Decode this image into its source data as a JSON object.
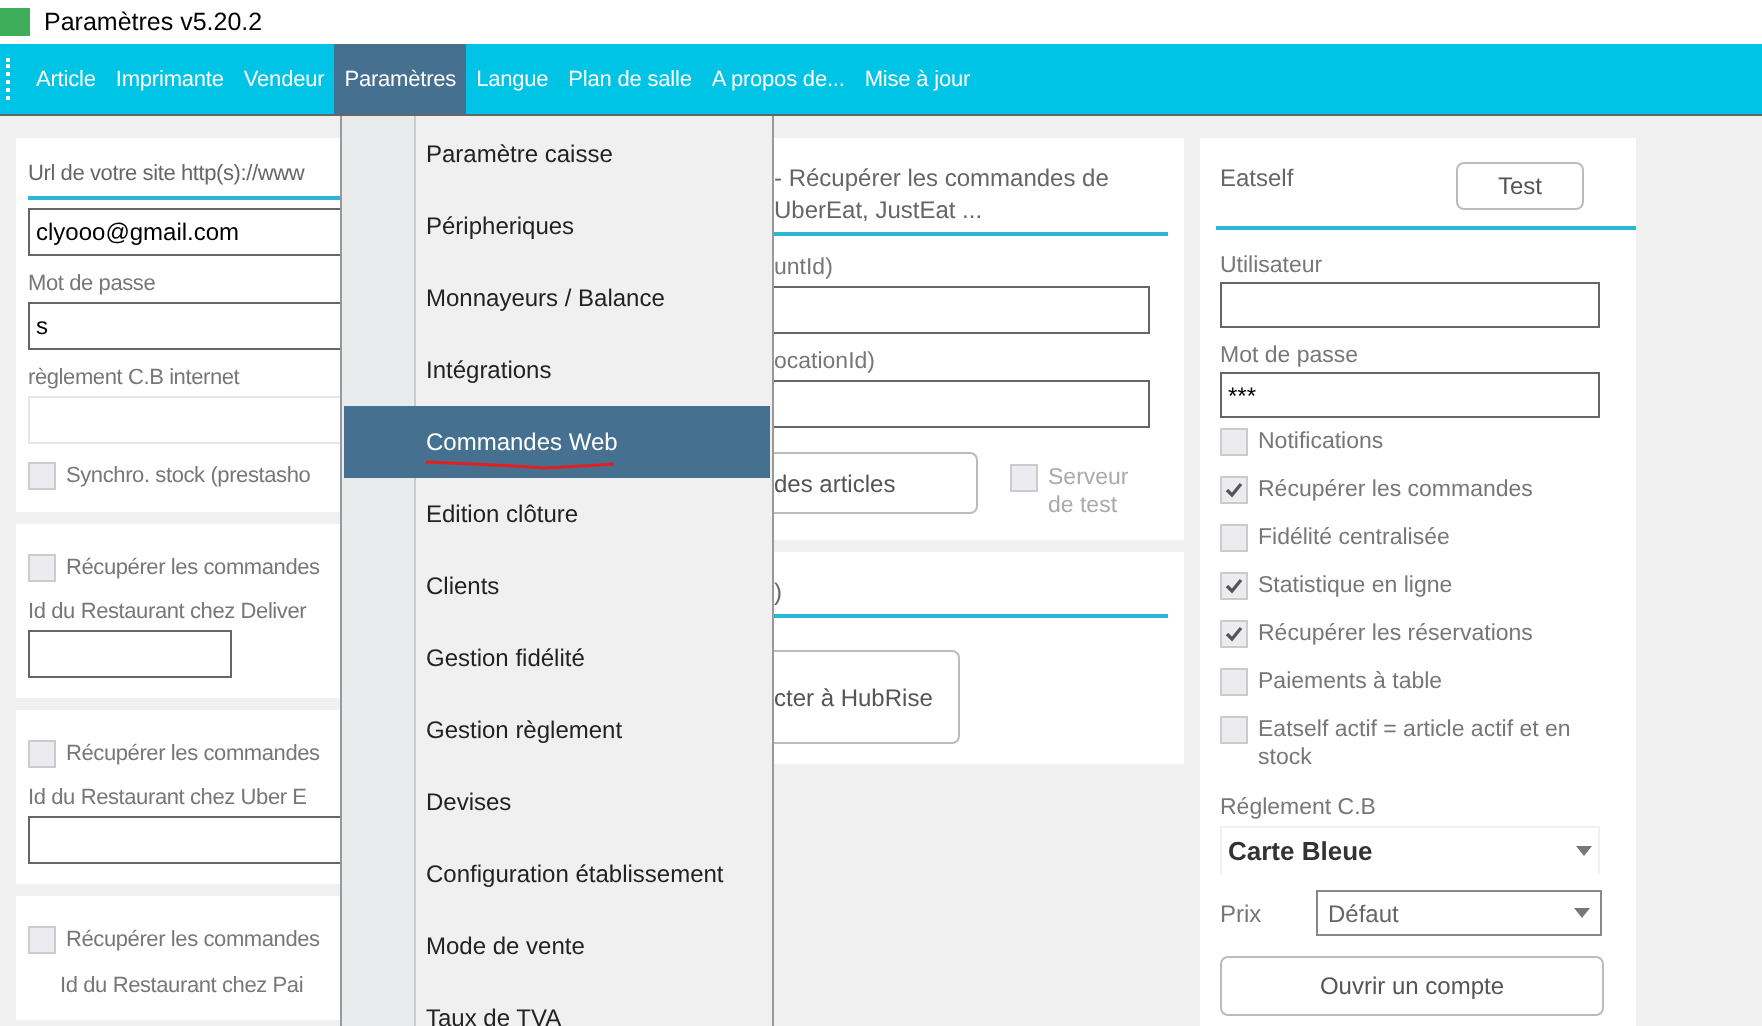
{
  "window": {
    "title": "Paramètres v5.20.2"
  },
  "menu_bar": [
    {
      "label": "Article",
      "selected": false
    },
    {
      "label": "Imprimante",
      "selected": false
    },
    {
      "label": "Vendeur",
      "selected": false
    },
    {
      "label": "Paramètres",
      "selected": true
    },
    {
      "label": "Langue",
      "selected": false
    },
    {
      "label": "Plan de salle",
      "selected": false
    },
    {
      "label": "A propos de...",
      "selected": false
    },
    {
      "label": "Mise à jour",
      "selected": false
    }
  ],
  "left_panels": [
    {
      "title": "Url de votre site http(s)://www",
      "rows": [
        {
          "kind": "input",
          "value": "clyooo@gmail.com"
        },
        {
          "kind": "label",
          "text": "Mot de passe"
        },
        {
          "kind": "input",
          "value": "s"
        },
        {
          "kind": "label",
          "text": "règlement C.B internet"
        },
        {
          "kind": "input",
          "disabled": true
        },
        {
          "kind": "checkbox",
          "label": "Synchro. stock (prestasho",
          "checked": false
        }
      ]
    },
    {
      "rows": [
        {
          "kind": "checkbox",
          "label": "Récupérer les commandes",
          "checked": false
        },
        {
          "kind": "label",
          "text": "Id du Restaurant chez Deliver"
        },
        {
          "kind": "input",
          "short": true
        }
      ]
    },
    {
      "rows": [
        {
          "kind": "checkbox",
          "label": "Récupérer les commandes",
          "checked": false
        },
        {
          "kind": "label",
          "text": "Id du Restaurant chez Uber E"
        },
        {
          "kind": "input"
        }
      ]
    },
    {
      "rows": [
        {
          "kind": "checkbox",
          "label": "Récupérer les commandes",
          "checked": false
        },
        {
          "kind": "note",
          "text": "Id du Restaurant chez Pai"
        }
      ]
    }
  ],
  "dropdown": {
    "items": [
      {
        "label": "Paramètre caisse",
        "selected": false,
        "marked": false
      },
      {
        "label": "Péripheriques",
        "selected": false,
        "marked": false
      },
      {
        "label": "Monnayeurs / Balance",
        "selected": false,
        "marked": false
      },
      {
        "label": "Intégrations",
        "selected": false,
        "marked": false
      },
      {
        "label": "Commandes Web",
        "selected": true,
        "marked": true
      },
      {
        "label": "Edition clôture",
        "selected": false,
        "marked": false
      },
      {
        "label": "Clients",
        "selected": false,
        "marked": false
      },
      {
        "label": "Gestion fidélité",
        "selected": false,
        "marked": false
      },
      {
        "label": "Gestion règlement",
        "selected": false,
        "marked": false
      },
      {
        "label": "Devises",
        "selected": false,
        "marked": false
      },
      {
        "label": "Configuration établissement",
        "selected": false,
        "marked": false
      },
      {
        "label": "Mode de vente",
        "selected": false,
        "marked": false
      },
      {
        "label": "Taux de TVA",
        "selected": false,
        "marked": false
      }
    ]
  },
  "middle_panels": [
    {
      "title": "- Récupérer les commandes de UberEat, JustEat ...",
      "rows": [
        {
          "kind": "label",
          "text": "untId)"
        },
        {
          "kind": "input"
        },
        {
          "kind": "label",
          "text": "ocationId)"
        },
        {
          "kind": "input"
        },
        {
          "kind": "button_row",
          "button": "des articles",
          "checkbox": {
            "label": "Serveur de test",
            "checked": false,
            "disabled": true
          }
        }
      ]
    },
    {
      "title": ")",
      "rows": [
        {
          "kind": "big_button",
          "label": "cter à HubRise"
        }
      ]
    }
  ],
  "eatself": {
    "title": "Eatself",
    "header_button": "Test",
    "rows": [
      {
        "kind": "label",
        "text": "Utilisateur"
      },
      {
        "kind": "input"
      },
      {
        "kind": "label",
        "text": "Mot de passe"
      },
      {
        "kind": "input",
        "value": "***"
      },
      {
        "kind": "checkbox",
        "label": "Notifications",
        "checked": false
      },
      {
        "kind": "checkbox",
        "label": "Récupérer les commandes",
        "checked": true
      },
      {
        "kind": "checkbox",
        "label": "Fidélité centralisée",
        "checked": false
      },
      {
        "kind": "checkbox",
        "label": "Statistique en ligne",
        "checked": true
      },
      {
        "kind": "checkbox",
        "label": "Récupérer les réservations",
        "checked": true
      },
      {
        "kind": "checkbox",
        "label": "Paiements à table",
        "checked": false
      },
      {
        "kind": "checkbox",
        "label": "Eatself actif = article actif et en stock",
        "checked": false
      },
      {
        "kind": "label",
        "text": "Réglement C.B"
      },
      {
        "kind": "combo",
        "value": "Carte Bleue"
      },
      {
        "kind": "select",
        "label": "Prix",
        "value": "Défaut"
      },
      {
        "kind": "wide_button",
        "label": "Ouvrir un compte"
      }
    ]
  }
}
